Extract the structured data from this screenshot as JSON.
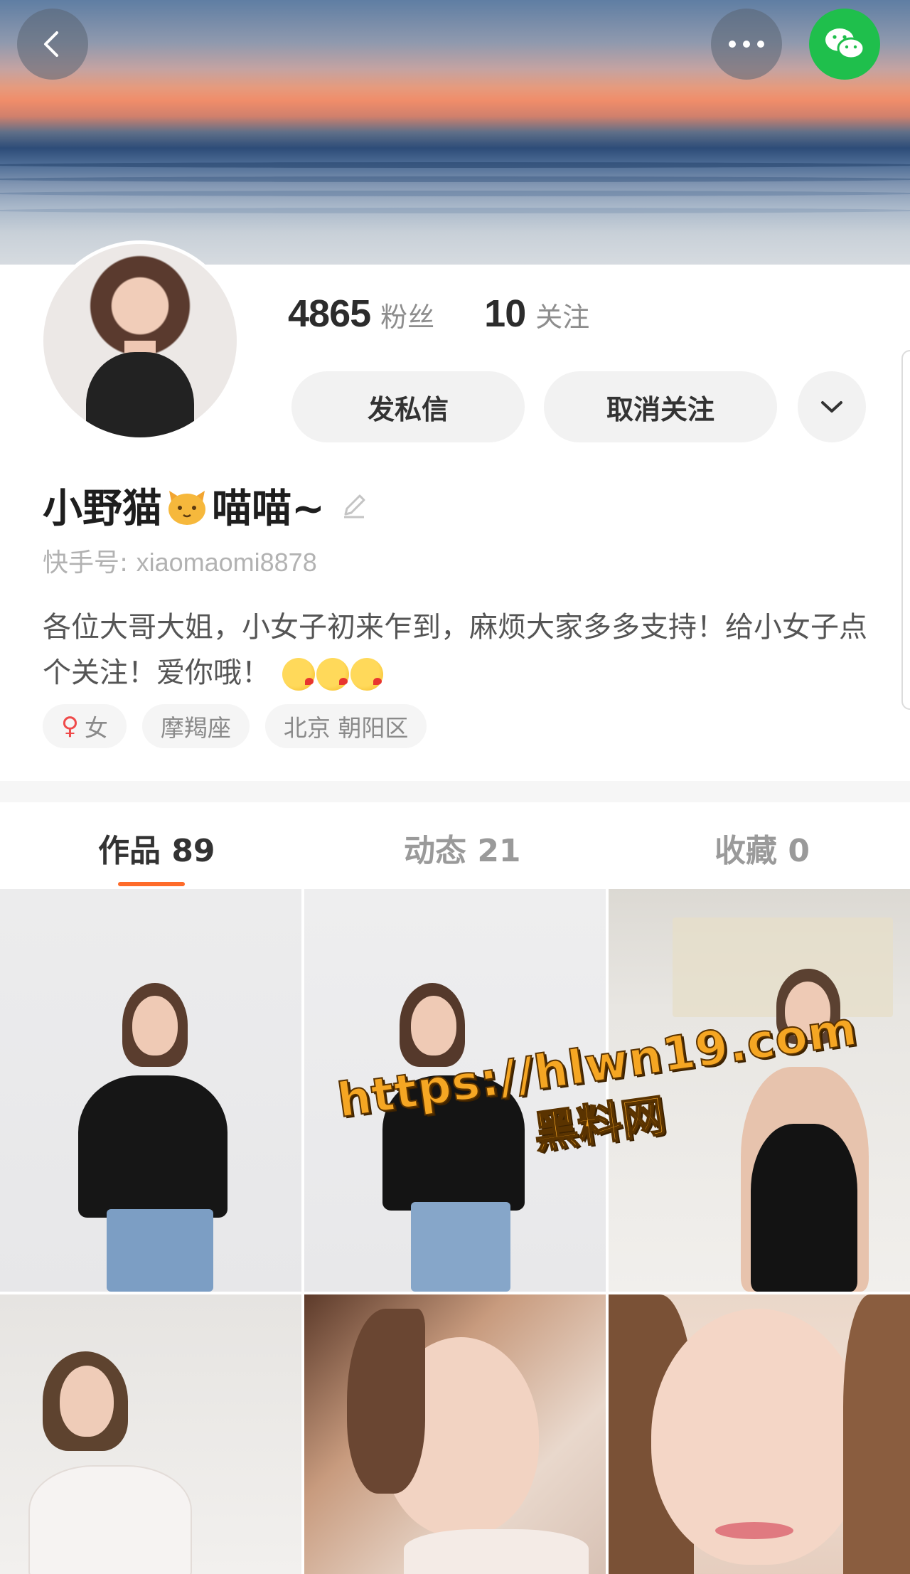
{
  "header": {
    "icons": {
      "back": "back-arrow-icon",
      "more": "more-dots-icon",
      "wechat": "wechat-icon"
    },
    "colors": {
      "wechat": "#1fbf4c"
    }
  },
  "profile": {
    "followers_count": "4865",
    "followers_label": "粉丝",
    "following_count": "10",
    "following_label": "关注",
    "message_button": "发私信",
    "unfollow_button": "取消关注",
    "nickname_part1": "小野猫",
    "nickname_part2": "喵喵~",
    "kuaishou_id_label": "快手号: ",
    "kuaishou_id": "xiaomaomi8878",
    "bio": "各位大哥大姐，小女子初来乍到，麻烦大家多多支持！给小女子点个关注！爱你哦！",
    "tags": [
      {
        "label": "女",
        "icon": "female-icon"
      },
      {
        "label": "摩羯座"
      },
      {
        "label": "北京 朝阳区"
      }
    ]
  },
  "tabs": [
    {
      "label": "作品 89",
      "active": true
    },
    {
      "label": "动态 21",
      "active": false
    },
    {
      "label": "收藏 0",
      "active": false
    }
  ],
  "accent_color": "#fe6b2a",
  "watermark": {
    "url": "https://hlwn19.com",
    "text": "黑料网"
  }
}
